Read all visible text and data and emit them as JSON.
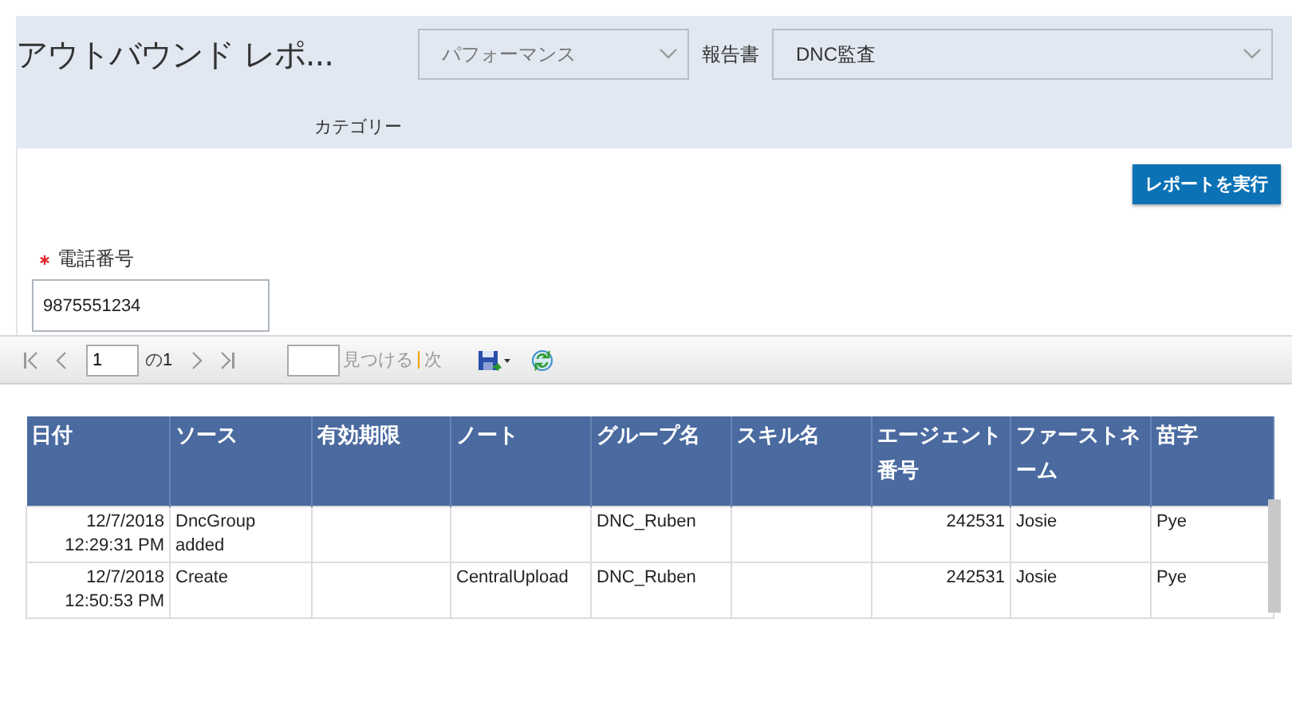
{
  "header": {
    "title": "アウトバウンド レポ...",
    "category": {
      "value": "パフォーマンス",
      "label": "カテゴリー"
    },
    "report": {
      "label": "報告書",
      "value": "DNC監査"
    }
  },
  "run_button": "レポートを実行",
  "phone": {
    "label": "電話番号",
    "required": true,
    "value": "9875551234"
  },
  "toolbar": {
    "page": "1",
    "of_label": "の",
    "total": "1",
    "find_label": "見つける",
    "next_label": "次"
  },
  "table": {
    "columns": [
      "日付",
      "ソース",
      "有効期限",
      "ノート",
      "グループ名",
      "スキル名",
      "エージェント番号",
      "ファーストネーム",
      "苗字"
    ],
    "rows": [
      [
        "12/7/2018\n12:29:31 PM",
        "DncGroup added",
        "",
        "",
        "DNC_Ruben",
        "",
        "242531",
        "Josie",
        " Pye"
      ],
      [
        "12/7/2018\n12:50:53 PM",
        "Create",
        "",
        "CentralUpload",
        "DNC_Ruben",
        "",
        "242531",
        "Josie",
        " Pye"
      ]
    ]
  }
}
